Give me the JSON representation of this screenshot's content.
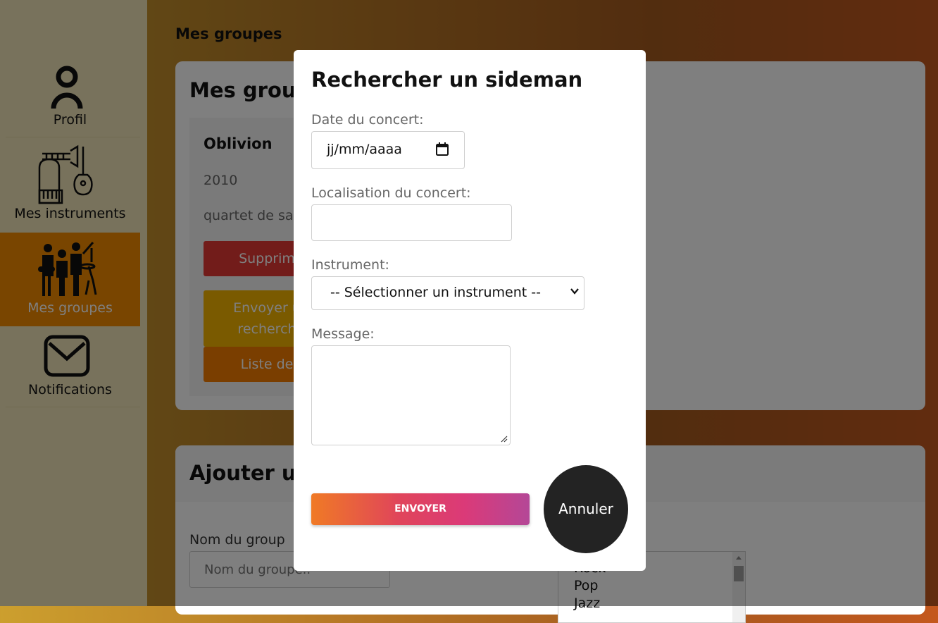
{
  "sidebar": {
    "items": [
      {
        "label": "Profil",
        "icon": "person-icon"
      },
      {
        "label": "Mes instruments",
        "icon": "instruments-icon"
      },
      {
        "label": "Mes groupes",
        "icon": "band-icon",
        "active": true
      },
      {
        "label": "Notifications",
        "icon": "envelope-icon"
      }
    ]
  },
  "main": {
    "title": "Mes groupes",
    "groups_card": {
      "heading": "Mes grou",
      "group": {
        "name": "Oblivion",
        "year": "2010",
        "description": "quartet de sa",
        "delete_label": "Supprim",
        "send_label_line1": "Envoyer u",
        "send_label_line2": "recherch",
        "list_label": "Liste de"
      }
    },
    "add_card": {
      "heading": "Ajouter u",
      "name_label": "Nom du group",
      "name_placeholder": "Nom du groupe..",
      "genres": [
        "Rock",
        "Pop",
        "Jazz"
      ]
    }
  },
  "modal": {
    "title": "Rechercher un sideman",
    "date_label": "Date du concert:",
    "date_placeholder": "jj/mm/aaaa",
    "location_label": "Localisation du concert:",
    "location_value": "",
    "instrument_label": "Instrument:",
    "instrument_selected": "-- Sélectionner un instrument --",
    "message_label": "Message:",
    "message_value": "",
    "send_button": "ENVOYER",
    "cancel_button": "Annuler"
  },
  "colors": {
    "active_nav": "#f28a00",
    "delete_button": "#e53935",
    "send_request_button": "#f5b400",
    "list_button": "#f57c00",
    "cancel_button": "#232323"
  }
}
